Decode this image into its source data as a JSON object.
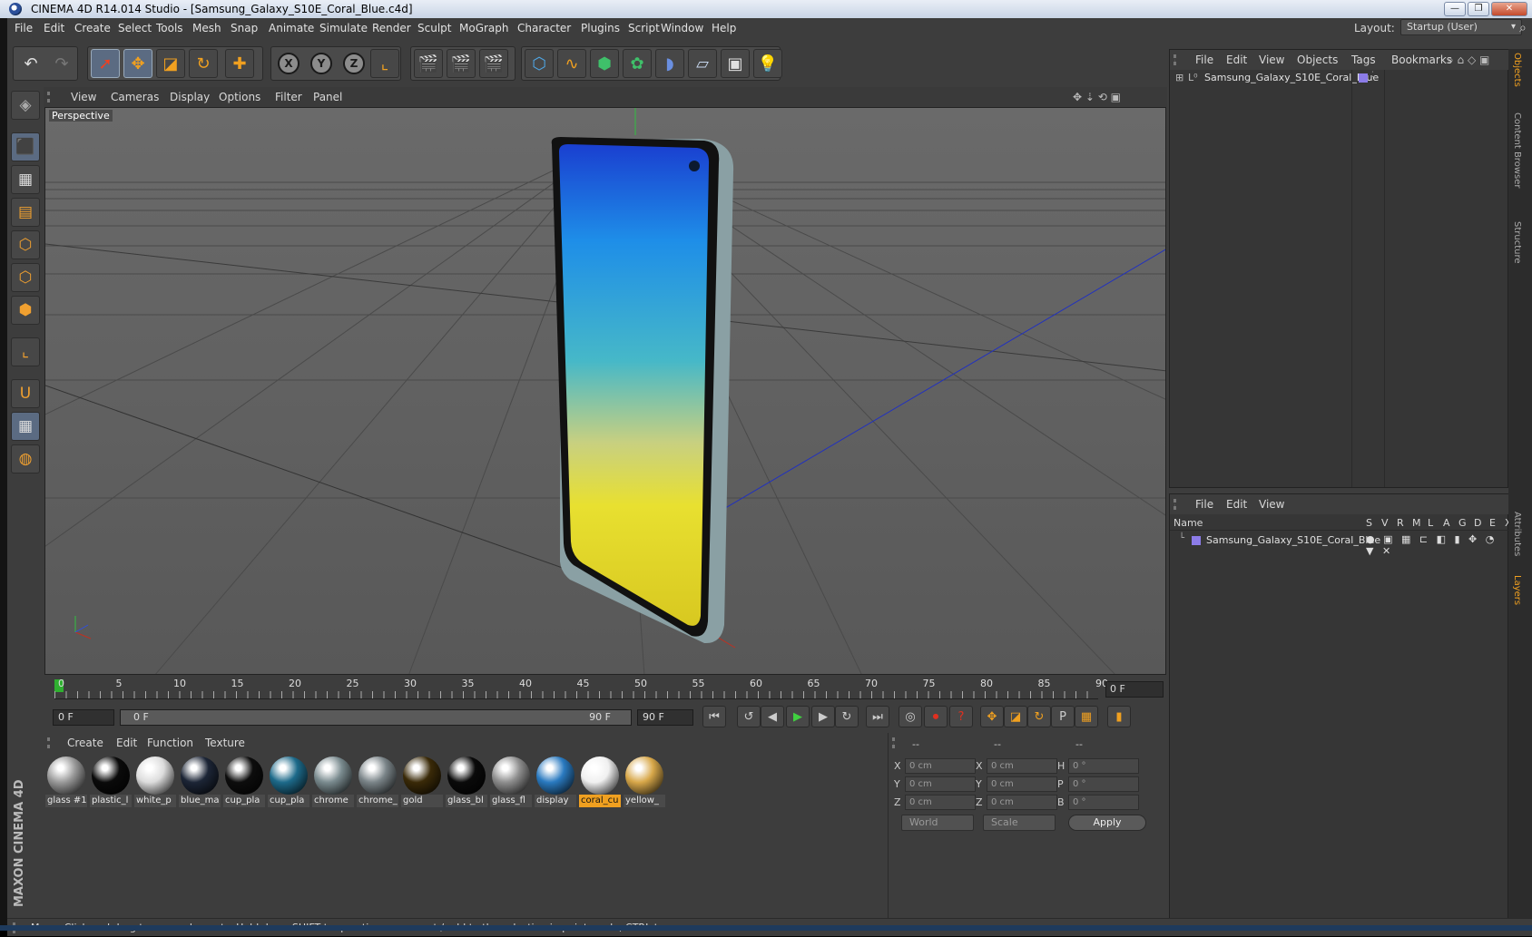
{
  "window": {
    "title": "CINEMA 4D R14.014 Studio - [Samsung_Galaxy_S10E_Coral_Blue.c4d]",
    "min": "—",
    "max": "❐",
    "close": "✕"
  },
  "menubar": {
    "items": [
      "File",
      "Edit",
      "Create",
      "Select",
      "Tools",
      "Mesh",
      "Snap",
      "Animate",
      "Simulate",
      "Render",
      "Sculpt",
      "MoGraph",
      "Character",
      "Plugins",
      "Script",
      "Window",
      "Help"
    ],
    "layout_label": "Layout:",
    "layout_value": "Startup (User)"
  },
  "viewport": {
    "menu": [
      "View",
      "Cameras",
      "Display",
      "Options",
      "Filter",
      "Panel"
    ],
    "label": "Perspective"
  },
  "timeline": {
    "ticks": [
      "0",
      "5",
      "10",
      "15",
      "20",
      "25",
      "30",
      "35",
      "40",
      "45",
      "50",
      "55",
      "60",
      "65",
      "70",
      "75",
      "80",
      "85",
      "90"
    ],
    "frame_field": "0 F",
    "start": "0 F",
    "range_start": "0 F",
    "range_end": "90 F",
    "end": "90 F"
  },
  "materials": {
    "menu": [
      "Create",
      "Edit",
      "Function",
      "Texture"
    ],
    "items": [
      {
        "name": "glass #1",
        "color": "#9a9a9a"
      },
      {
        "name": "plastic_l",
        "color": "#0a0a0a"
      },
      {
        "name": "white_p",
        "color": "#dcdcdc"
      },
      {
        "name": "blue_ma",
        "color": "#1c2536"
      },
      {
        "name": "cup_pla",
        "color": "#0d0d0d"
      },
      {
        "name": "cup_pla",
        "color": "#1d6a8a"
      },
      {
        "name": "chrome",
        "color": "#7a8b8f"
      },
      {
        "name": "chrome_",
        "color": "#7a8488"
      },
      {
        "name": "gold",
        "color": "#3a2a08"
      },
      {
        "name": "glass_bl",
        "color": "#0a0a0a"
      },
      {
        "name": "glass_fl",
        "color": "#8e8e8e"
      },
      {
        "name": "display",
        "color": "#2a7ac0"
      },
      {
        "name": "coral_cu",
        "color": "#f0f0f0"
      },
      {
        "name": "yellow_",
        "color": "#d8a84a"
      }
    ]
  },
  "coords": {
    "headers": [
      "--",
      "--",
      "--"
    ],
    "rows": [
      {
        "l1": "X",
        "v1": "0 cm",
        "l2": "X",
        "v2": "0 cm",
        "l3": "H",
        "v3": "0 °"
      },
      {
        "l1": "Y",
        "v1": "0 cm",
        "l2": "Y",
        "v2": "0 cm",
        "l3": "P",
        "v3": "0 °"
      },
      {
        "l1": "Z",
        "v1": "0 cm",
        "l2": "Z",
        "v2": "0 cm",
        "l3": "B",
        "v3": "0 °"
      }
    ],
    "world": "World",
    "scale": "Scale",
    "apply": "Apply"
  },
  "objects": {
    "menu": [
      "File",
      "Edit",
      "View",
      "Objects",
      "Tags",
      "Bookmarks"
    ],
    "item": "Samsung_Galaxy_S10E_Coral_Blue"
  },
  "layers": {
    "menu": [
      "File",
      "Edit",
      "View"
    ],
    "name_header": "Name",
    "cols": [
      "S",
      "V",
      "R",
      "M",
      "L",
      "A",
      "G",
      "D",
      "E",
      "X"
    ],
    "item": "Samsung_Galaxy_S10E_Coral_Blue"
  },
  "sidetabs": {
    "top": [
      "Objects",
      "Content Browser",
      "Structure"
    ],
    "bottom": [
      "Attributes",
      "Layers"
    ]
  },
  "status": "Move: Click and drag to move elements. Hold down SHIFT to quantize movement / add to the selection in point mode, CTRL to remove.",
  "brand": "MAXON CINEMA 4D"
}
